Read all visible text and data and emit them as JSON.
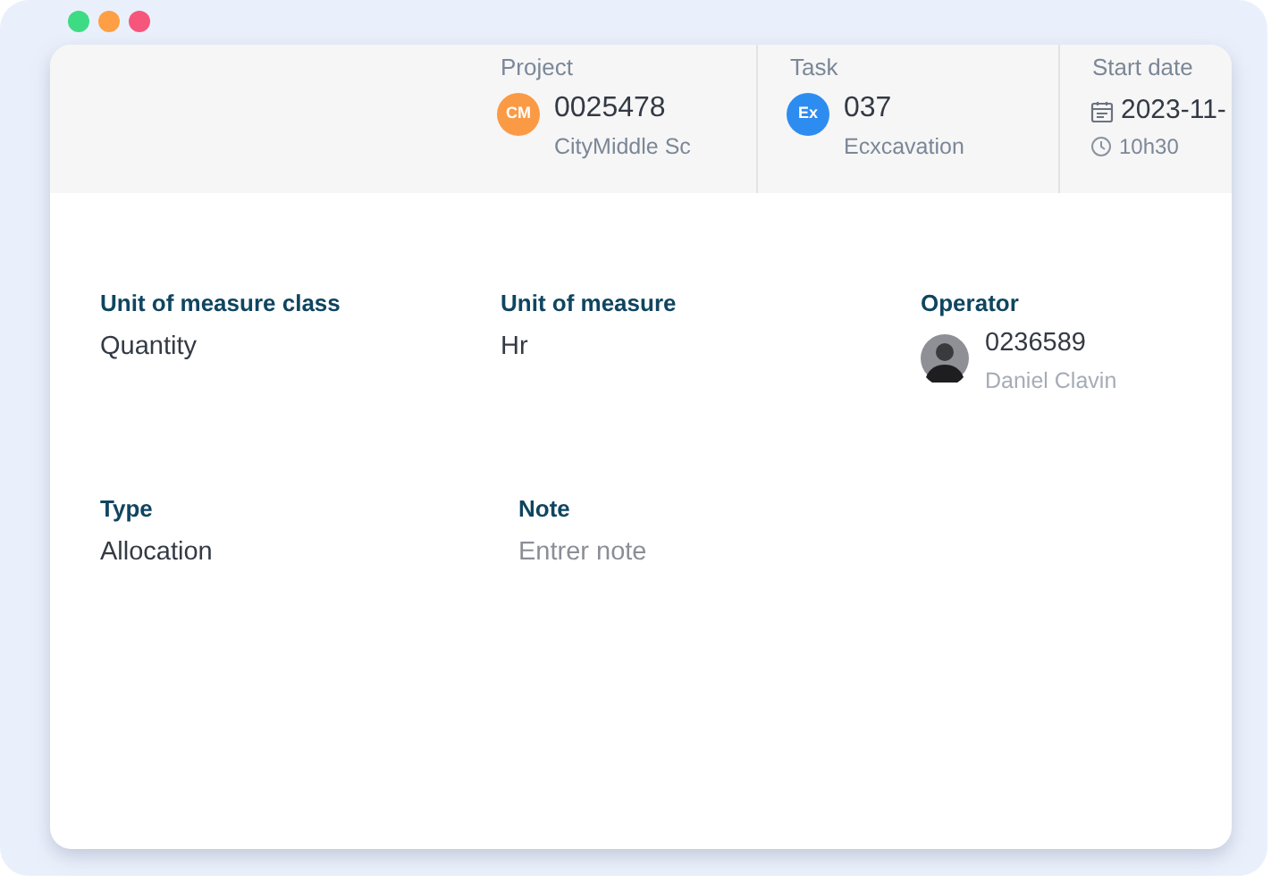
{
  "window_controls": [
    {
      "color": "#3ddc84"
    },
    {
      "color": "#ff9f43"
    },
    {
      "color": "#f7567c"
    }
  ],
  "header": [
    {
      "kind": "badge",
      "label": "Project",
      "badge": "CM",
      "color": "#fb9a45",
      "value": "0025478",
      "sub": "CityMiddle Sc"
    },
    {
      "kind": "badge",
      "label": "Task",
      "badge": "Ex",
      "color": "#2d8cf0",
      "value": "037",
      "sub": "Ecxcavation"
    },
    {
      "kind": "date",
      "label": "Start date",
      "value": "2023-11-",
      "sub": "10h30"
    }
  ],
  "fields": [
    {
      "kind": "text",
      "label": "Unit of measure class",
      "value": "Quantity"
    },
    {
      "kind": "text",
      "label": "Unit of measure",
      "value": "Hr"
    },
    {
      "kind": "person",
      "label": "Operator",
      "value": "0236589",
      "sub": "Daniel Clavin"
    },
    {
      "kind": "text",
      "label": "Type",
      "value": "Allocation"
    },
    {
      "kind": "input",
      "label": "Note",
      "placeholder": "Entrer note"
    }
  ]
}
